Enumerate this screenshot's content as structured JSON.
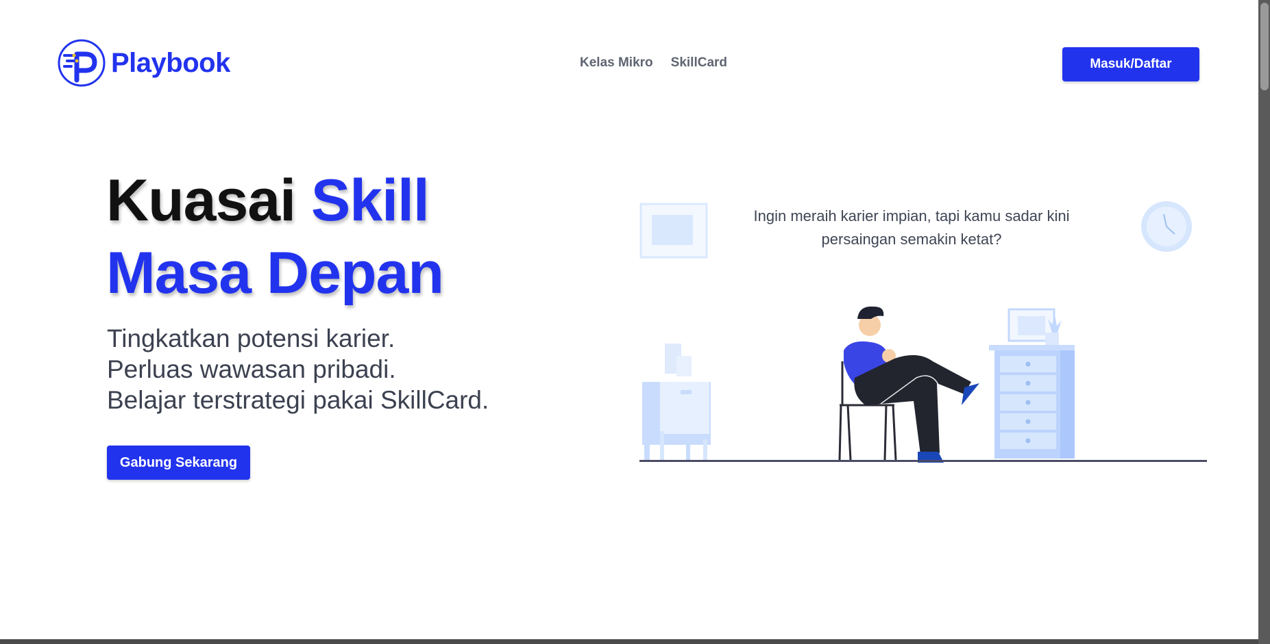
{
  "brand": {
    "name": "Playbook",
    "color": "#2233ee"
  },
  "nav": {
    "items": [
      {
        "label": "Kelas Mikro"
      },
      {
        "label": "SkillCard"
      }
    ]
  },
  "header": {
    "login_button": "Masuk/Daftar"
  },
  "hero": {
    "title_part1": "Kuasai ",
    "title_part2": "Skill",
    "title_line2": "Masa Depan",
    "subtitle_lines": [
      "Tingkatkan potensi karier.",
      "Perluas wawasan pribadi.",
      "Belajar terstrategi pakai SkillCard."
    ],
    "cta_button": "Gabung Sekarang"
  },
  "illustration": {
    "caption_line1": "Ingin meraih karier impian, tapi kamu sadar kini",
    "caption_line2": "persaingan semakin ketat?"
  },
  "colors": {
    "accent": "#2233ee",
    "text_dark": "#111111",
    "text_muted": "#3c4150",
    "illustration_light": "#b9d2ff"
  }
}
